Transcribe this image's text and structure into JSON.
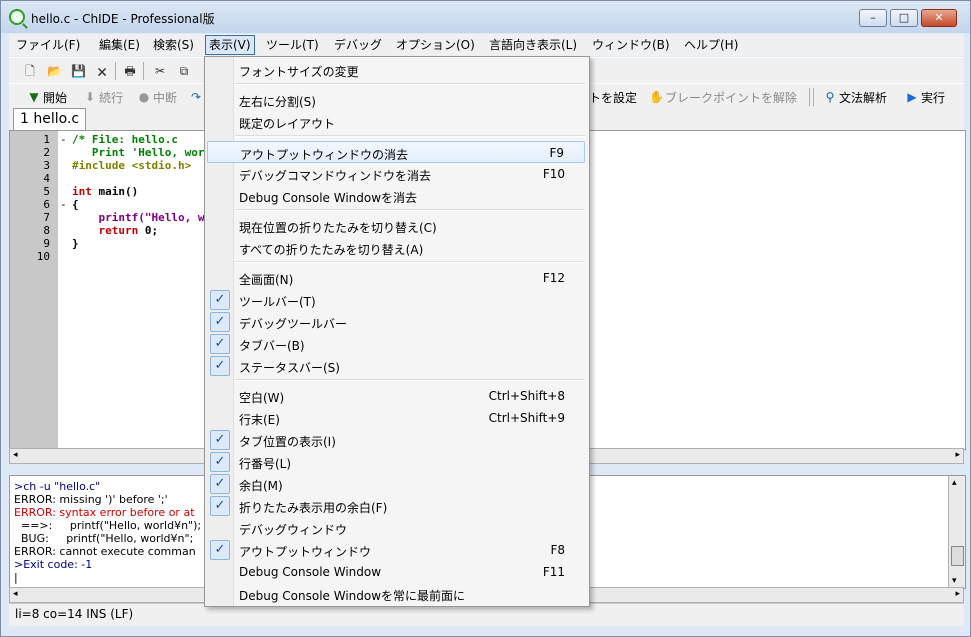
{
  "window": {
    "title": "hello.c - ChIDE - Professional版",
    "buttons": {
      "minimize": "–",
      "maximize": "□",
      "close": "✕"
    }
  },
  "menubar": [
    {
      "label": "ファイル(F)"
    },
    {
      "label": "編集(E)"
    },
    {
      "label": "検索(S)"
    },
    {
      "label": "表示(V)"
    },
    {
      "label": "ツール(T)"
    },
    {
      "label": "デバッグ"
    },
    {
      "label": "オプション(O)"
    },
    {
      "label": "言語向き表示(L)"
    },
    {
      "label": "ウィンドウ(B)"
    },
    {
      "label": "ヘルプ(H)"
    }
  ],
  "debug_toolbar": {
    "start": "開始",
    "continue": "続行",
    "stop": "中断",
    "set_breakpoint_suffix": "トを設定",
    "clear_breakpoint": "ブレークポイントを解除",
    "parse": "文法解析",
    "run": "実行"
  },
  "tab": {
    "label": "1 hello.c"
  },
  "editor": {
    "line_numbers": [
      "1",
      "2",
      "3",
      "4",
      "5",
      "6",
      "7",
      "8",
      "9",
      "10"
    ],
    "lines": [
      {
        "fold": "-",
        "text": "/* File: hello.c",
        "cls": "c-cmt"
      },
      {
        "fold": "",
        "text": "   Print 'Hello, worl",
        "cls": "c-cmt"
      },
      {
        "fold": "",
        "text": "#include <stdio.h>",
        "cls": "c-pp"
      },
      {
        "fold": "",
        "text": "",
        "cls": "c-n"
      },
      {
        "fold": "",
        "text": "int main()",
        "cls": "c-kw"
      },
      {
        "fold": "-",
        "text": "{",
        "cls": "c-n"
      },
      {
        "fold": "",
        "text": "    printf(\"Hello, wor",
        "cls": "c-fn"
      },
      {
        "fold": "",
        "text": "    return 0;",
        "cls": "c-kw"
      },
      {
        "fold": "",
        "text": "}",
        "cls": "c-n"
      },
      {
        "fold": "",
        "text": "",
        "cls": "c-n"
      }
    ]
  },
  "output": {
    "lines": [
      {
        "text": ">ch -u \"hello.c\"",
        "color": "#000080"
      },
      {
        "text": "ERROR: missing ')' before ';'",
        "color": "#000000"
      },
      {
        "text": "ERROR: syntax error before or at",
        "color": "#cc0000"
      },
      {
        "text": "  ==>:     printf(\"Hello, world¥n\");",
        "color": "#000000"
      },
      {
        "text": "  BUG:     printf(\"Hello, world¥n\"; ",
        "color": "#000000"
      },
      {
        "text": "ERROR: cannot execute comman",
        "color": "#000000"
      },
      {
        "text": ">Exit code: -1",
        "color": "#000080"
      },
      {
        "text": "|",
        "color": "#000000"
      }
    ]
  },
  "status": {
    "text": "li=8 co=14 INS (LF)"
  },
  "view_menu": {
    "items": [
      {
        "label": "フォントサイズの変更",
        "shortcut": "",
        "checked": false,
        "highlight": false
      },
      {
        "sep": true
      },
      {
        "label": "左右に分割(S)",
        "shortcut": "",
        "checked": false,
        "highlight": false
      },
      {
        "label": "既定のレイアウト",
        "shortcut": "",
        "checked": false,
        "highlight": false
      },
      {
        "sep": true
      },
      {
        "label": "アウトプットウィンドウの消去",
        "shortcut": "F9",
        "checked": false,
        "highlight": true
      },
      {
        "label": "デバッグコマンドウィンドウを消去",
        "shortcut": "F10",
        "checked": false,
        "highlight": false
      },
      {
        "label": "Debug Console Windowを消去",
        "shortcut": "",
        "checked": false,
        "highlight": false
      },
      {
        "sep": true
      },
      {
        "label": "現在位置の折りたたみを切り替え(C)",
        "shortcut": "",
        "checked": false,
        "highlight": false
      },
      {
        "label": "すべての折りたたみを切り替え(A)",
        "shortcut": "",
        "checked": false,
        "highlight": false
      },
      {
        "sep": true
      },
      {
        "label": "全画面(N)",
        "shortcut": "F12",
        "checked": false,
        "highlight": false
      },
      {
        "label": "ツールバー(T)",
        "shortcut": "",
        "checked": true,
        "highlight": false
      },
      {
        "label": "デバッグツールバー",
        "shortcut": "",
        "checked": true,
        "highlight": false
      },
      {
        "label": "タブバー(B)",
        "shortcut": "",
        "checked": true,
        "highlight": false
      },
      {
        "label": "ステータスバー(S)",
        "shortcut": "",
        "checked": true,
        "highlight": false
      },
      {
        "sep": true
      },
      {
        "label": "空白(W)",
        "shortcut": "Ctrl+Shift+8",
        "checked": false,
        "highlight": false
      },
      {
        "label": "行末(E)",
        "shortcut": "Ctrl+Shift+9",
        "checked": false,
        "highlight": false
      },
      {
        "label": "タブ位置の表示(I)",
        "shortcut": "",
        "checked": true,
        "highlight": false
      },
      {
        "label": "行番号(L)",
        "shortcut": "",
        "checked": true,
        "highlight": false
      },
      {
        "label": "余白(M)",
        "shortcut": "",
        "checked": true,
        "highlight": false
      },
      {
        "label": "折りたたみ表示用の余白(F)",
        "shortcut": "",
        "checked": true,
        "highlight": false
      },
      {
        "label": "デバッグウィンドウ",
        "shortcut": "",
        "checked": false,
        "highlight": false
      },
      {
        "label": "アウトプットウィンドウ",
        "shortcut": "F8",
        "checked": true,
        "highlight": false
      },
      {
        "label": "Debug Console Window",
        "shortcut": "F11",
        "checked": false,
        "highlight": false
      },
      {
        "label": "Debug Console Windowを常に最前面に",
        "shortcut": "",
        "checked": false,
        "highlight": false
      }
    ]
  }
}
